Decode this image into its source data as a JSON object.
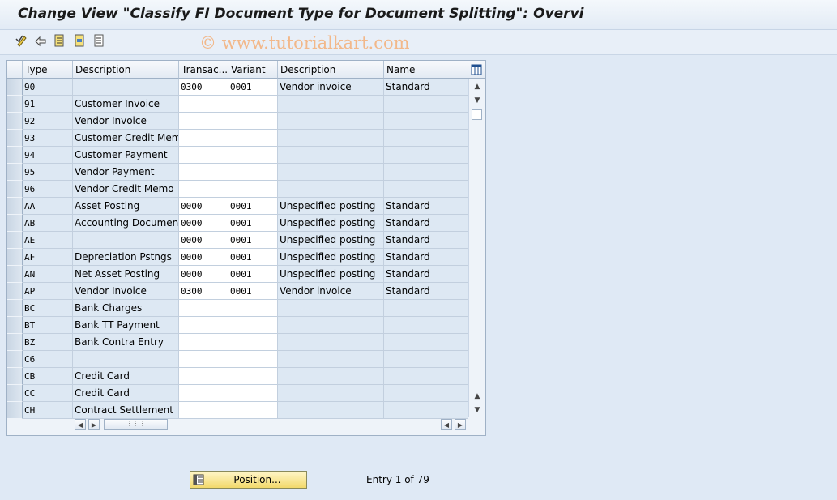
{
  "window": {
    "title": "Change View \"Classify FI Document Type for Document Splitting\": Overvi",
    "watermark": "© www.tutorialkart.com"
  },
  "toolbar": {
    "icons": [
      "change-display-icon",
      "undo-icon",
      "select-all-icon",
      "select-block-icon",
      "deselect-all-icon"
    ]
  },
  "table": {
    "columns": [
      "Type",
      "Description",
      "Transac...",
      "Variant",
      "Description",
      "Name"
    ],
    "rows": [
      {
        "type": "90",
        "desc": "",
        "trans": "0300",
        "variant": "0001",
        "desc2": "Vendor invoice",
        "name": "Standard"
      },
      {
        "type": "91",
        "desc": "Customer Invoice",
        "trans": "",
        "variant": "",
        "desc2": "",
        "name": ""
      },
      {
        "type": "92",
        "desc": "Vendor Invoice",
        "trans": "",
        "variant": "",
        "desc2": "",
        "name": ""
      },
      {
        "type": "93",
        "desc": "Customer Credit Memo",
        "trans": "",
        "variant": "",
        "desc2": "",
        "name": ""
      },
      {
        "type": "94",
        "desc": "Customer Payment",
        "trans": "",
        "variant": "",
        "desc2": "",
        "name": ""
      },
      {
        "type": "95",
        "desc": "Vendor Payment",
        "trans": "",
        "variant": "",
        "desc2": "",
        "name": ""
      },
      {
        "type": "96",
        "desc": "Vendor Credit Memo",
        "trans": "",
        "variant": "",
        "desc2": "",
        "name": ""
      },
      {
        "type": "AA",
        "desc": "Asset Posting",
        "trans": "0000",
        "variant": "0001",
        "desc2": "Unspecified posting",
        "name": "Standard"
      },
      {
        "type": "AB",
        "desc": "Accounting Document",
        "trans": "0000",
        "variant": "0001",
        "desc2": "Unspecified posting",
        "name": "Standard"
      },
      {
        "type": "AE",
        "desc": "",
        "trans": "0000",
        "variant": "0001",
        "desc2": "Unspecified posting",
        "name": "Standard"
      },
      {
        "type": "AF",
        "desc": "Depreciation Pstngs",
        "trans": "0000",
        "variant": "0001",
        "desc2": "Unspecified posting",
        "name": "Standard"
      },
      {
        "type": "AN",
        "desc": "Net Asset Posting",
        "trans": "0000",
        "variant": "0001",
        "desc2": "Unspecified posting",
        "name": "Standard"
      },
      {
        "type": "AP",
        "desc": "Vendor Invoice",
        "trans": "0300",
        "variant": "0001",
        "desc2": "Vendor invoice",
        "name": "Standard"
      },
      {
        "type": "BC",
        "desc": "Bank Charges",
        "trans": "",
        "variant": "",
        "desc2": "",
        "name": ""
      },
      {
        "type": "BT",
        "desc": "Bank TT Payment",
        "trans": "",
        "variant": "",
        "desc2": "",
        "name": ""
      },
      {
        "type": "BZ",
        "desc": "Bank Contra Entry",
        "trans": "",
        "variant": "",
        "desc2": "",
        "name": ""
      },
      {
        "type": "C6",
        "desc": "",
        "trans": "",
        "variant": "",
        "desc2": "",
        "name": ""
      },
      {
        "type": "CB",
        "desc": "Credit Card",
        "trans": "",
        "variant": "",
        "desc2": "",
        "name": ""
      },
      {
        "type": "CC",
        "desc": "Credit Card",
        "trans": "",
        "variant": "",
        "desc2": "",
        "name": ""
      },
      {
        "type": "CH",
        "desc": "Contract Settlement",
        "trans": "",
        "variant": "",
        "desc2": "",
        "name": ""
      }
    ]
  },
  "footer": {
    "position_label": "Position...",
    "entry_text": "Entry 1 of 79"
  }
}
